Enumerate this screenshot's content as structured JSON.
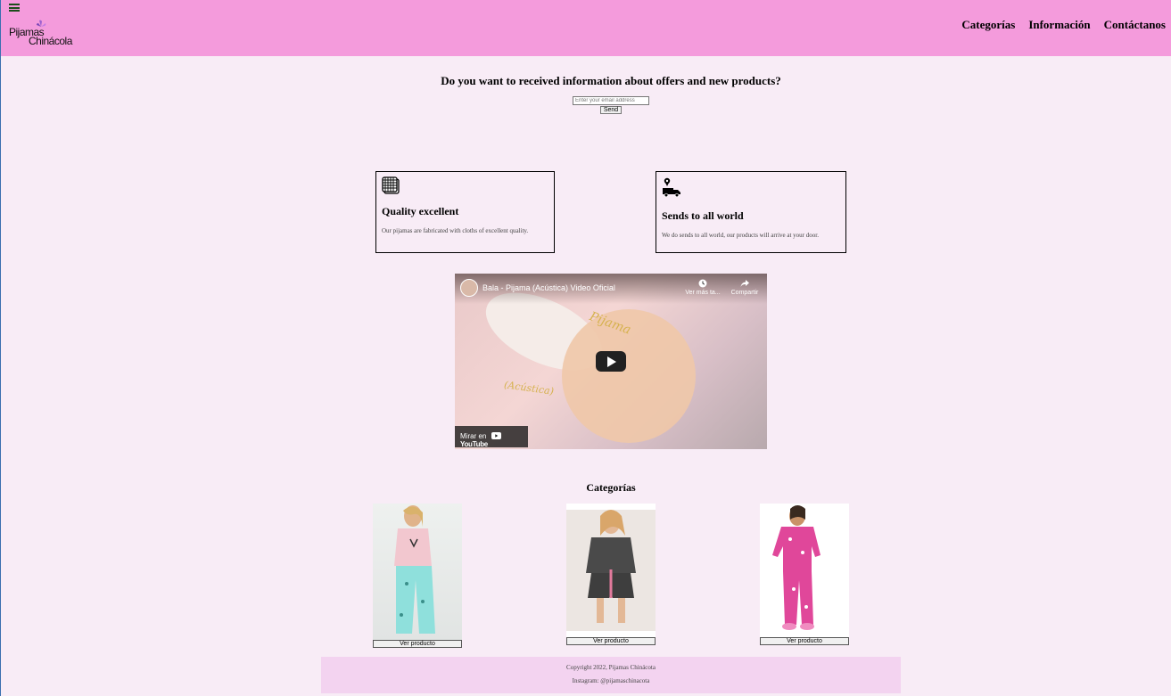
{
  "header": {
    "logo_line1": "Pijamas",
    "logo_line2": "Chinácola",
    "nav": [
      "Categorías",
      "Información",
      "Contáctanos"
    ]
  },
  "subscribe": {
    "title": "Do you want to received information about offers and new products?",
    "email_placeholder": "Enter your email address",
    "send_label": "Send"
  },
  "features": [
    {
      "icon": "fabric-icon",
      "title": "Quality excellent",
      "text": "Our pijamas are fabricated with cloths of excellent quality."
    },
    {
      "icon": "delivery-truck-icon",
      "title": "Sends to all world",
      "text": "We do sends to all world, our products will arrive at your door."
    }
  ],
  "video": {
    "title": "Bala - Pijama (Acústica) Video Oficial",
    "watch_later": "Ver más ta...",
    "share": "Compartir",
    "watch_on": "Mirar en",
    "youtube": "YouTube",
    "script1": "Pijama",
    "script2": "(Acústica)"
  },
  "categories": {
    "title": "Categorías",
    "products": [
      {
        "button": "Ver producto",
        "color": "#f3c1d3"
      },
      {
        "button": "Ver producto",
        "color": "#4a4a4a"
      },
      {
        "button": "Ver producto",
        "color": "#e0479a"
      }
    ]
  },
  "footer": {
    "copyright": "Copyright 2022, Pijamas Chinácota",
    "instagram": "Instagram: @pijamaschinacota"
  },
  "colors": {
    "header_bg": "#f49bdc",
    "page_bg": "#f8ecf6",
    "footer_bg": "#f3d3f0"
  }
}
